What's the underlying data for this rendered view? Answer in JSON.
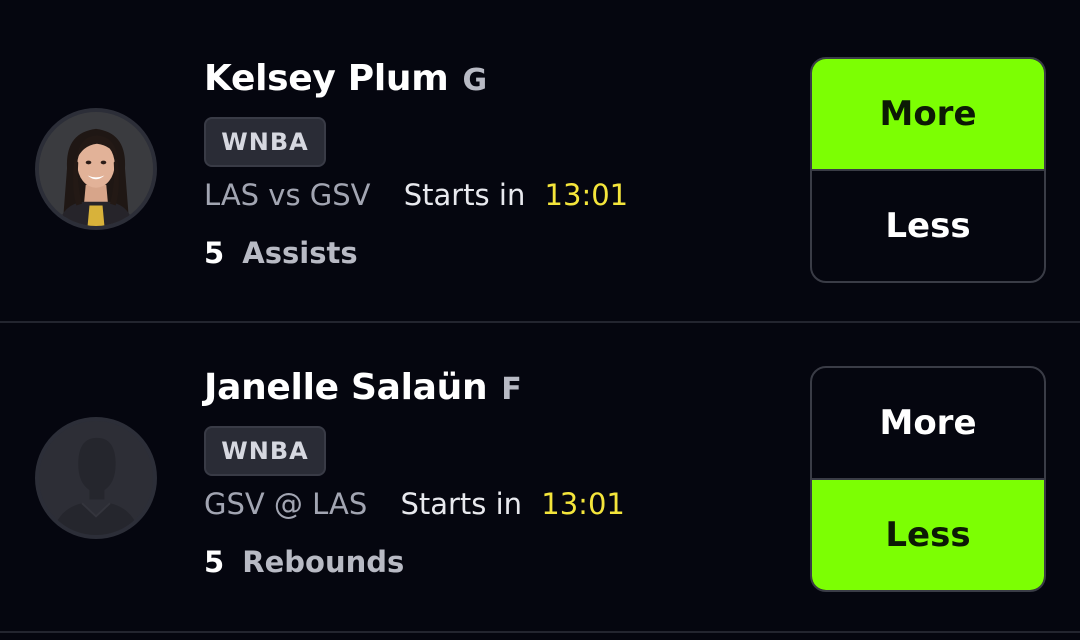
{
  "players": [
    {
      "name": "Kelsey Plum",
      "position": "G",
      "league": "WNBA",
      "matchup": "LAS vs GSV",
      "starts_label": "Starts in",
      "countdown": "13:01",
      "stat_value": "5",
      "stat_name": "Assists",
      "more_label": "More",
      "less_label": "Less",
      "selected": "more",
      "avatar": "player-photo"
    },
    {
      "name": "Janelle Salaün",
      "position": "F",
      "league": "WNBA",
      "matchup": "GSV @ LAS",
      "starts_label": "Starts in",
      "countdown": "13:01",
      "stat_value": "5",
      "stat_name": "Rebounds",
      "more_label": "More",
      "less_label": "Less",
      "selected": "less",
      "avatar": "silhouette-placeholder"
    }
  ],
  "colors": {
    "background": "#05060f",
    "selected_green": "#7cff03",
    "countdown_yellow": "#f4e53b",
    "badge_bg": "#2a2c36"
  }
}
